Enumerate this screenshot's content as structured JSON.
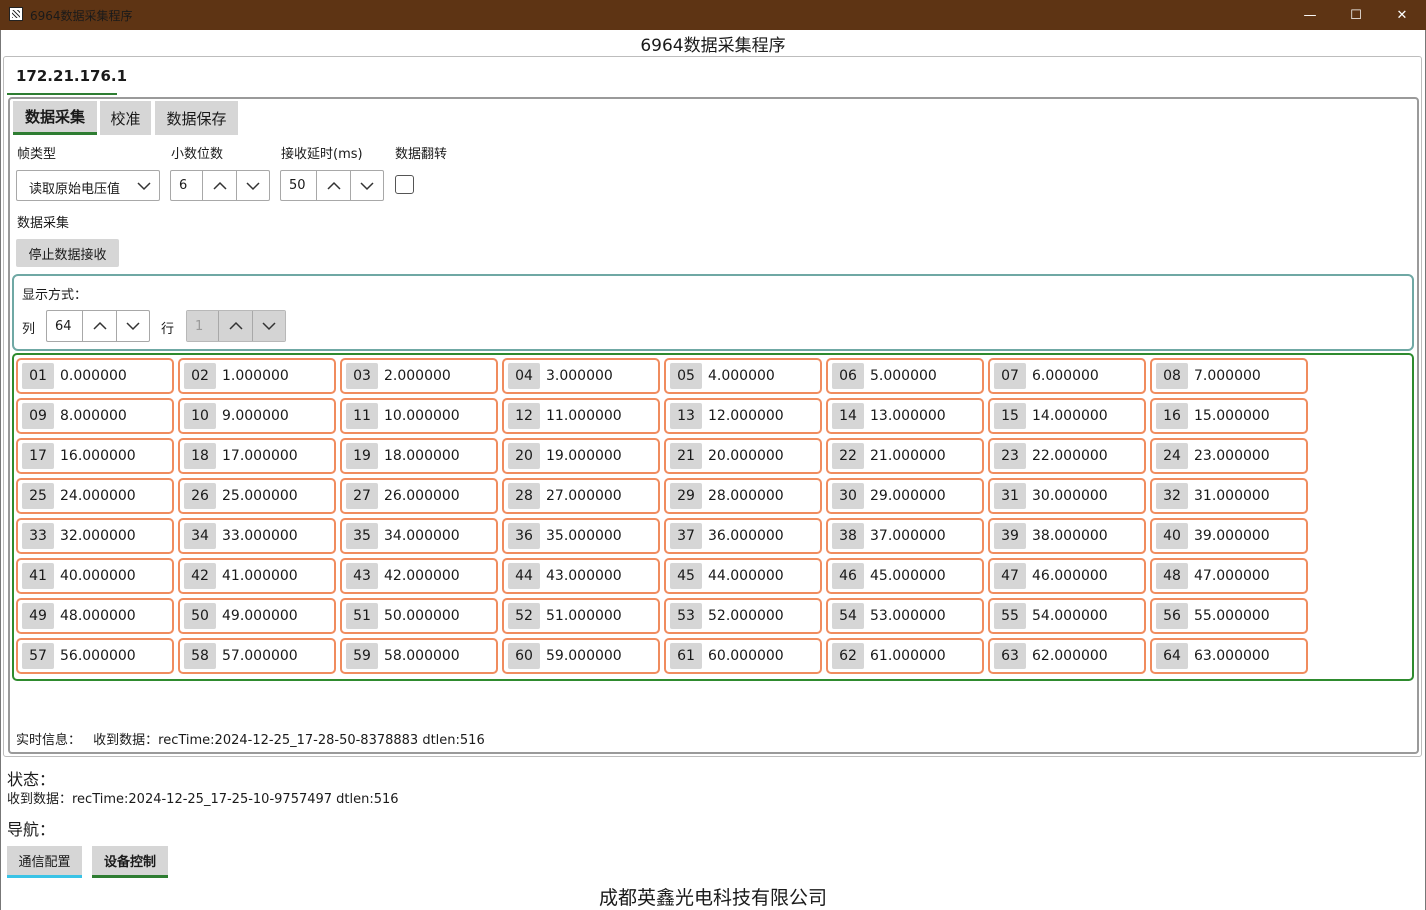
{
  "window": {
    "title": "6964数据采集程序",
    "minimize": "—",
    "maximize": "☐",
    "close": "✕"
  },
  "app": {
    "heading": "6964数据采集程序"
  },
  "device_tab": {
    "label": "172.21.176.1"
  },
  "subtabs": [
    {
      "label": "数据采集",
      "active": true
    },
    {
      "label": "校准",
      "active": false
    },
    {
      "label": "数据保存",
      "active": false
    }
  ],
  "settings": {
    "frame_type": {
      "label": "帧类型",
      "value": "读取原始电压值"
    },
    "decimals": {
      "label": "小数位数",
      "value": "6"
    },
    "recv_delay": {
      "label": "接收延时(ms)",
      "value": "50"
    },
    "data_flip": {
      "label": "数据翻转",
      "checked": false
    }
  },
  "acquisition": {
    "label": "数据采集",
    "stop_button": "停止数据接收"
  },
  "display_mode": {
    "title": "显示方式：",
    "columns_label": "列",
    "columns_value": "64",
    "rows_label": "行",
    "rows_value": "1"
  },
  "channels": [
    {
      "index": "01",
      "value": "0.000000"
    },
    {
      "index": "02",
      "value": "1.000000"
    },
    {
      "index": "03",
      "value": "2.000000"
    },
    {
      "index": "04",
      "value": "3.000000"
    },
    {
      "index": "05",
      "value": "4.000000"
    },
    {
      "index": "06",
      "value": "5.000000"
    },
    {
      "index": "07",
      "value": "6.000000"
    },
    {
      "index": "08",
      "value": "7.000000"
    },
    {
      "index": "09",
      "value": "8.000000"
    },
    {
      "index": "10",
      "value": "9.000000"
    },
    {
      "index": "11",
      "value": "10.000000"
    },
    {
      "index": "12",
      "value": "11.000000"
    },
    {
      "index": "13",
      "value": "12.000000"
    },
    {
      "index": "14",
      "value": "13.000000"
    },
    {
      "index": "15",
      "value": "14.000000"
    },
    {
      "index": "16",
      "value": "15.000000"
    },
    {
      "index": "17",
      "value": "16.000000"
    },
    {
      "index": "18",
      "value": "17.000000"
    },
    {
      "index": "19",
      "value": "18.000000"
    },
    {
      "index": "20",
      "value": "19.000000"
    },
    {
      "index": "21",
      "value": "20.000000"
    },
    {
      "index": "22",
      "value": "21.000000"
    },
    {
      "index": "23",
      "value": "22.000000"
    },
    {
      "index": "24",
      "value": "23.000000"
    },
    {
      "index": "25",
      "value": "24.000000"
    },
    {
      "index": "26",
      "value": "25.000000"
    },
    {
      "index": "27",
      "value": "26.000000"
    },
    {
      "index": "28",
      "value": "27.000000"
    },
    {
      "index": "29",
      "value": "28.000000"
    },
    {
      "index": "30",
      "value": "29.000000"
    },
    {
      "index": "31",
      "value": "30.000000"
    },
    {
      "index": "32",
      "value": "31.000000"
    },
    {
      "index": "33",
      "value": "32.000000"
    },
    {
      "index": "34",
      "value": "33.000000"
    },
    {
      "index": "35",
      "value": "34.000000"
    },
    {
      "index": "36",
      "value": "35.000000"
    },
    {
      "index": "37",
      "value": "36.000000"
    },
    {
      "index": "38",
      "value": "37.000000"
    },
    {
      "index": "39",
      "value": "38.000000"
    },
    {
      "index": "40",
      "value": "39.000000"
    },
    {
      "index": "41",
      "value": "40.000000"
    },
    {
      "index": "42",
      "value": "41.000000"
    },
    {
      "index": "43",
      "value": "42.000000"
    },
    {
      "index": "44",
      "value": "43.000000"
    },
    {
      "index": "45",
      "value": "44.000000"
    },
    {
      "index": "46",
      "value": "45.000000"
    },
    {
      "index": "47",
      "value": "46.000000"
    },
    {
      "index": "48",
      "value": "47.000000"
    },
    {
      "index": "49",
      "value": "48.000000"
    },
    {
      "index": "50",
      "value": "49.000000"
    },
    {
      "index": "51",
      "value": "50.000000"
    },
    {
      "index": "52",
      "value": "51.000000"
    },
    {
      "index": "53",
      "value": "52.000000"
    },
    {
      "index": "54",
      "value": "53.000000"
    },
    {
      "index": "55",
      "value": "54.000000"
    },
    {
      "index": "56",
      "value": "55.000000"
    },
    {
      "index": "57",
      "value": "56.000000"
    },
    {
      "index": "58",
      "value": "57.000000"
    },
    {
      "index": "59",
      "value": "58.000000"
    },
    {
      "index": "60",
      "value": "59.000000"
    },
    {
      "index": "61",
      "value": "60.000000"
    },
    {
      "index": "62",
      "value": "61.000000"
    },
    {
      "index": "63",
      "value": "62.000000"
    },
    {
      "index": "64",
      "value": "63.000000"
    }
  ],
  "realtime": {
    "label": "实时信息：",
    "message": "收到数据：recTime:2024-12-25_17-28-50-8378883 dtlen:516"
  },
  "status": {
    "title": "状态：",
    "message": "收到数据：recTime:2024-12-25_17-25-10-9757497 dtlen:516"
  },
  "navigation": {
    "title": "导航：",
    "buttons": [
      {
        "label": "通信配置",
        "accent": "#39c3e6"
      },
      {
        "label": "设备控制",
        "accent": "#2e7d32"
      }
    ]
  },
  "footer": {
    "company": "成都英鑫光电科技有限公司"
  },
  "colors": {
    "titlebar": "#5e3414",
    "tab_accent": "#2e7d32",
    "cell_border": "#f08c5e",
    "grid_border": "#2e8b2e",
    "display_border": "#6fa8a4"
  },
  "icons": {
    "spin_up": "chevron-up-icon",
    "spin_down": "chevron-down-icon",
    "dropdown": "chevron-down-icon"
  }
}
